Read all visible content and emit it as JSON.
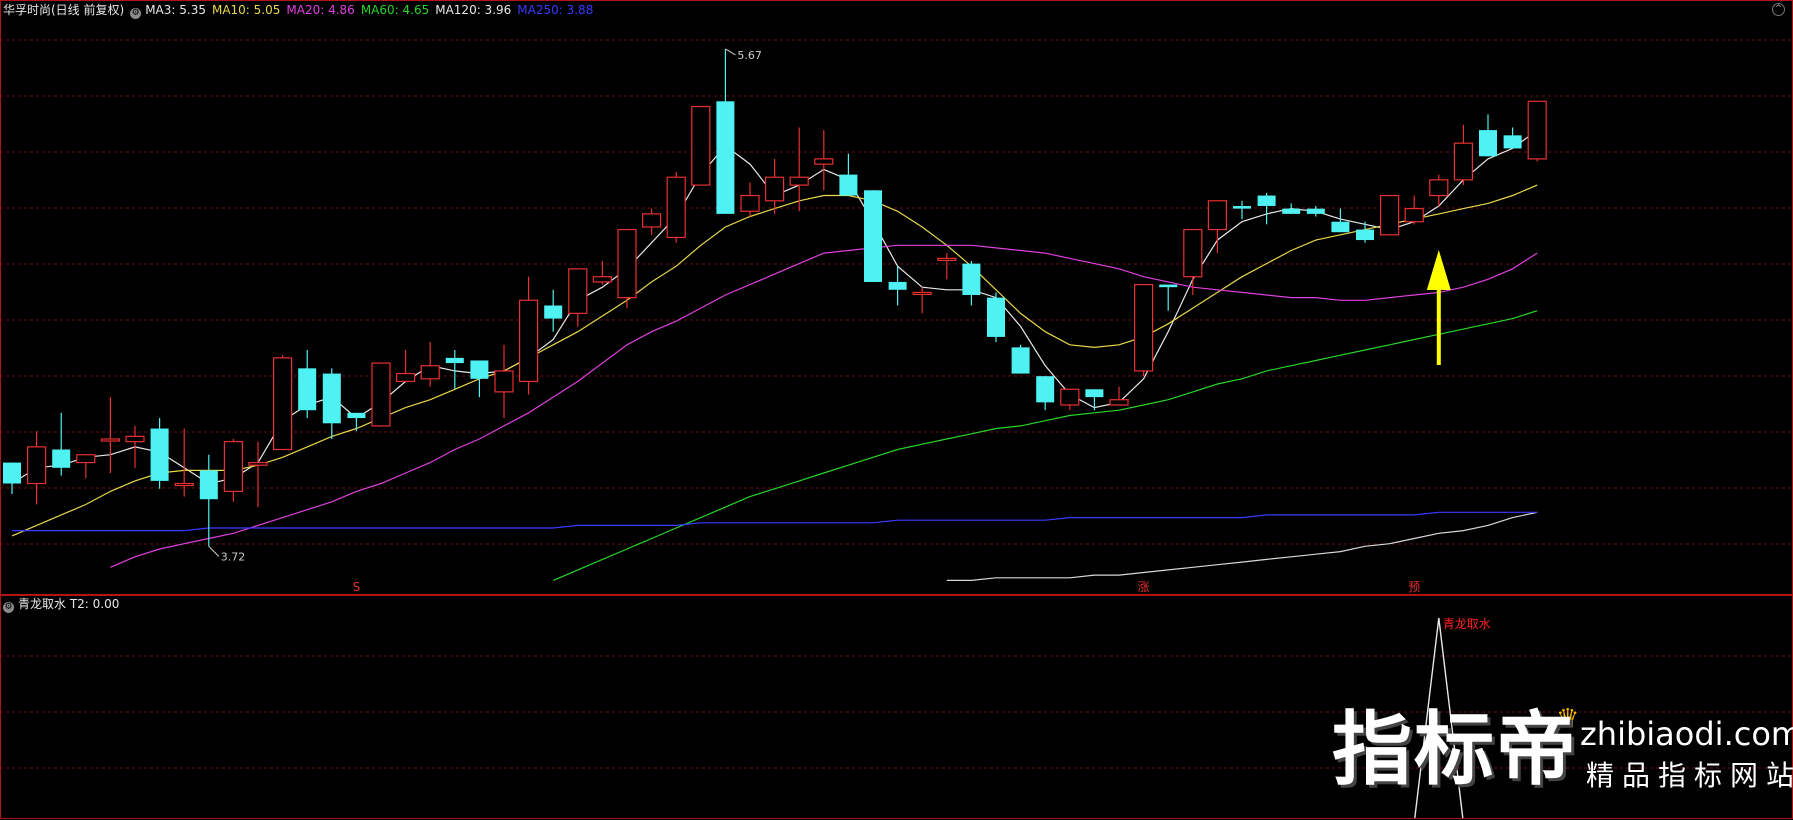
{
  "header": {
    "title": "华孚时尚(日线 前复权)",
    "ma": [
      {
        "label": "MA3: 5.35",
        "color": "#e8e8e8"
      },
      {
        "label": "MA10: 5.05",
        "color": "#e8d84a"
      },
      {
        "label": "MA20: 4.86",
        "color": "#e040e0"
      },
      {
        "label": "MA60: 4.65",
        "color": "#26d626"
      },
      {
        "label": "MA120: 3.96",
        "color": "#e8e8e8"
      },
      {
        "label": "MA250: 3.88",
        "color": "#3a3aff"
      }
    ]
  },
  "sub_header": {
    "label": "青龙取水  T2: 0.00"
  },
  "watermark": {
    "big": "指标帝",
    "site": "zhibiaodi.com",
    "tag": "精品指标网站"
  },
  "colors": {
    "up": "#e83030",
    "down": "#4ef2f2",
    "ma3": "#e8e8e8",
    "ma10": "#e8d84a",
    "ma20": "#e040e0",
    "ma60": "#26d626",
    "ma120": "#d8d8d8",
    "ma250": "#3a3aff",
    "arrow": "#ffff00",
    "signal": "#e8e8e8",
    "signal_text": "#ff2020",
    "grid": "#6a0f0f"
  },
  "chart_data": {
    "type": "candlestick",
    "y_range": [
      3.62,
      5.74
    ],
    "max_label": "5.67",
    "min_label": "3.72",
    "ohlc": [
      [
        4.08,
        4.08,
        3.96,
        4.0
      ],
      [
        4.0,
        4.2,
        3.92,
        4.14
      ],
      [
        4.13,
        4.27,
        4.03,
        4.06
      ],
      [
        4.08,
        4.11,
        4.02,
        4.11
      ],
      [
        4.17,
        4.33,
        4.04,
        4.17
      ],
      [
        4.16,
        4.22,
        4.06,
        4.18
      ],
      [
        4.21,
        4.25,
        3.98,
        4.01
      ],
      [
        4.0,
        4.21,
        3.95,
        4.0
      ],
      [
        4.05,
        4.11,
        3.76,
        3.94
      ],
      [
        3.97,
        4.17,
        3.93,
        4.16
      ],
      [
        4.07,
        4.16,
        3.91,
        4.08
      ],
      [
        4.13,
        4.49,
        4.13,
        4.48
      ],
      [
        4.44,
        4.51,
        4.25,
        4.28
      ],
      [
        4.42,
        4.44,
        4.17,
        4.23
      ],
      [
        4.27,
        4.27,
        4.2,
        4.25
      ],
      [
        4.22,
        4.46,
        4.22,
        4.46
      ],
      [
        4.39,
        4.51,
        4.39,
        4.42
      ],
      [
        4.4,
        4.54,
        4.37,
        4.45
      ],
      [
        4.48,
        4.51,
        4.36,
        4.46
      ],
      [
        4.47,
        4.46,
        4.33,
        4.4
      ],
      [
        4.35,
        4.53,
        4.25,
        4.43
      ],
      [
        4.39,
        4.79,
        4.34,
        4.7
      ],
      [
        4.68,
        4.74,
        4.58,
        4.63
      ],
      [
        4.65,
        4.76,
        4.6,
        4.82
      ],
      [
        4.77,
        4.85,
        4.76,
        4.79
      ],
      [
        4.71,
        4.97,
        4.67,
        4.97
      ],
      [
        4.98,
        5.05,
        4.95,
        5.03
      ],
      [
        4.94,
        5.19,
        4.92,
        5.17
      ],
      [
        5.14,
        5.3,
        5.15,
        5.44
      ],
      [
        5.46,
        5.66,
        5.05,
        5.03
      ],
      [
        5.04,
        5.15,
        5.02,
        5.1
      ],
      [
        5.08,
        5.24,
        5.03,
        5.17
      ],
      [
        5.14,
        5.36,
        5.04,
        5.17
      ],
      [
        5.22,
        5.35,
        5.12,
        5.24
      ],
      [
        5.18,
        5.26,
        5.12,
        5.1
      ],
      [
        5.12,
        5.12,
        4.82,
        4.77
      ],
      [
        4.77,
        4.83,
        4.68,
        4.74
      ],
      [
        4.73,
        4.75,
        4.65,
        4.73
      ],
      [
        4.86,
        4.88,
        4.78,
        4.86
      ],
      [
        4.84,
        4.85,
        4.68,
        4.72
      ],
      [
        4.71,
        4.73,
        4.54,
        4.56
      ],
      [
        4.52,
        4.53,
        4.46,
        4.42
      ],
      [
        4.41,
        4.41,
        4.28,
        4.31
      ],
      [
        4.3,
        4.3,
        4.28,
        4.36
      ],
      [
        4.36,
        4.36,
        4.28,
        4.33
      ],
      [
        4.3,
        4.37,
        4.31,
        4.32
      ],
      [
        4.43,
        4.74,
        4.41,
        4.76
      ],
      [
        4.76,
        4.76,
        4.66,
        4.75
      ],
      [
        4.79,
        4.94,
        4.72,
        4.97
      ],
      [
        4.97,
        4.98,
        4.88,
        5.08
      ],
      [
        5.06,
        5.08,
        5.01,
        5.05
      ],
      [
        5.1,
        5.11,
        4.99,
        5.06
      ],
      [
        5.05,
        5.07,
        5.04,
        5.03
      ],
      [
        5.05,
        5.06,
        5.02,
        5.03
      ],
      [
        5.0,
        5.05,
        4.97,
        4.96
      ],
      [
        4.97,
        5.0,
        4.92,
        4.93
      ],
      [
        4.95,
        5.01,
        4.98,
        5.1
      ],
      [
        5.0,
        5.1,
        4.99,
        5.05
      ],
      [
        5.1,
        5.18,
        5.06,
        5.16
      ],
      [
        5.16,
        5.37,
        5.14,
        5.3
      ],
      [
        5.35,
        5.41,
        5.3,
        5.25
      ],
      [
        5.33,
        5.36,
        5.29,
        5.28
      ],
      [
        5.24,
        5.42,
        5.23,
        5.46
      ]
    ],
    "ma": [
      {
        "name": "MA3",
        "color": "#e8e8e8",
        "values": [
          4.0,
          4.06,
          4.07,
          4.1,
          4.11,
          4.14,
          4.12,
          4.06,
          4.0,
          4.02,
          4.08,
          4.24,
          4.3,
          4.33,
          4.25,
          4.31,
          4.39,
          4.45,
          4.43,
          4.42,
          4.43,
          4.48,
          4.55,
          4.7,
          4.75,
          4.82,
          4.92,
          5.02,
          5.18,
          5.29,
          5.22,
          5.1,
          5.14,
          5.2,
          5.16,
          5.0,
          4.83,
          4.75,
          4.74,
          4.74,
          4.71,
          4.6,
          4.45,
          4.34,
          4.29,
          4.31,
          4.4,
          4.58,
          4.78,
          4.93,
          5.0,
          5.03,
          5.05,
          5.04,
          5.01,
          4.99,
          4.97,
          5.0,
          5.06,
          5.16,
          5.24,
          5.28,
          5.35
        ]
      },
      {
        "name": "MA10",
        "color": "#e8d84a",
        "values": [
          3.8,
          3.84,
          3.88,
          3.92,
          3.97,
          4.01,
          4.04,
          4.05,
          4.05,
          4.05,
          4.07,
          4.1,
          4.14,
          4.18,
          4.21,
          4.25,
          4.29,
          4.32,
          4.36,
          4.4,
          4.43,
          4.48,
          4.53,
          4.58,
          4.64,
          4.7,
          4.77,
          4.83,
          4.91,
          4.98,
          5.02,
          5.05,
          5.08,
          5.1,
          5.1,
          5.08,
          5.04,
          4.98,
          4.91,
          4.83,
          4.74,
          4.65,
          4.58,
          4.53,
          4.52,
          4.53,
          4.56,
          4.61,
          4.67,
          4.73,
          4.79,
          4.84,
          4.89,
          4.93,
          4.95,
          4.97,
          4.99,
          5.01,
          5.03,
          5.05,
          5.07,
          5.1,
          5.14
        ]
      },
      {
        "name": "MA20",
        "color": "#e040e0",
        "values": [
          null,
          null,
          null,
          null,
          3.68,
          3.72,
          3.75,
          3.77,
          3.79,
          3.81,
          3.84,
          3.87,
          3.9,
          3.93,
          3.97,
          4.0,
          4.04,
          4.08,
          4.13,
          4.17,
          4.22,
          4.27,
          4.33,
          4.39,
          4.46,
          4.53,
          4.58,
          4.62,
          4.67,
          4.72,
          4.76,
          4.8,
          4.84,
          4.88,
          4.89,
          4.9,
          4.91,
          4.91,
          4.91,
          4.91,
          4.9,
          4.89,
          4.88,
          4.86,
          4.84,
          4.82,
          4.79,
          4.77,
          4.75,
          4.74,
          4.73,
          4.72,
          4.71,
          4.71,
          4.7,
          4.7,
          4.71,
          4.72,
          4.73,
          4.75,
          4.78,
          4.82,
          4.88
        ]
      },
      {
        "name": "MA60",
        "color": "#26d626",
        "values": [
          null,
          null,
          null,
          null,
          null,
          null,
          null,
          null,
          null,
          null,
          null,
          null,
          null,
          null,
          null,
          null,
          null,
          null,
          null,
          null,
          null,
          null,
          3.63,
          3.67,
          3.71,
          3.75,
          3.79,
          3.83,
          3.87,
          3.91,
          3.95,
          3.98,
          4.01,
          4.04,
          4.07,
          4.1,
          4.13,
          4.15,
          4.17,
          4.19,
          4.21,
          4.22,
          4.24,
          4.26,
          4.27,
          4.28,
          4.3,
          4.32,
          4.35,
          4.38,
          4.4,
          4.43,
          4.45,
          4.47,
          4.49,
          4.51,
          4.53,
          4.55,
          4.57,
          4.59,
          4.61,
          4.63,
          4.66
        ]
      },
      {
        "name": "MA120",
        "color": "#d8d8d8",
        "values": [
          null,
          null,
          null,
          null,
          null,
          null,
          null,
          null,
          null,
          null,
          null,
          null,
          null,
          null,
          null,
          null,
          null,
          null,
          null,
          null,
          null,
          null,
          null,
          null,
          null,
          null,
          null,
          null,
          null,
          null,
          null,
          null,
          null,
          null,
          null,
          null,
          null,
          null,
          3.63,
          3.63,
          3.64,
          3.64,
          3.64,
          3.64,
          3.65,
          3.65,
          3.66,
          3.67,
          3.68,
          3.69,
          3.7,
          3.71,
          3.72,
          3.73,
          3.74,
          3.76,
          3.77,
          3.79,
          3.81,
          3.82,
          3.84,
          3.87,
          3.89
        ]
      },
      {
        "name": "MA250",
        "color": "#3a3aff",
        "values": [
          3.82,
          3.82,
          3.82,
          3.82,
          3.82,
          3.82,
          3.82,
          3.82,
          3.83,
          3.83,
          3.83,
          3.83,
          3.83,
          3.83,
          3.83,
          3.83,
          3.83,
          3.83,
          3.83,
          3.83,
          3.83,
          3.83,
          3.83,
          3.84,
          3.84,
          3.84,
          3.84,
          3.84,
          3.85,
          3.85,
          3.85,
          3.85,
          3.85,
          3.85,
          3.85,
          3.85,
          3.86,
          3.86,
          3.86,
          3.86,
          3.86,
          3.86,
          3.86,
          3.87,
          3.87,
          3.87,
          3.87,
          3.87,
          3.87,
          3.87,
          3.87,
          3.88,
          3.88,
          3.88,
          3.88,
          3.88,
          3.88,
          3.88,
          3.89,
          3.89,
          3.89,
          3.89,
          3.89
        ]
      }
    ],
    "markers": [
      {
        "index": 14,
        "text": "S"
      },
      {
        "index": 46,
        "text": "涨"
      },
      {
        "index": 57,
        "text": "预"
      }
    ],
    "arrow_index": 58,
    "signal": {
      "name": "青龙取水",
      "peak_index": 58,
      "label": "青龙取水"
    }
  }
}
